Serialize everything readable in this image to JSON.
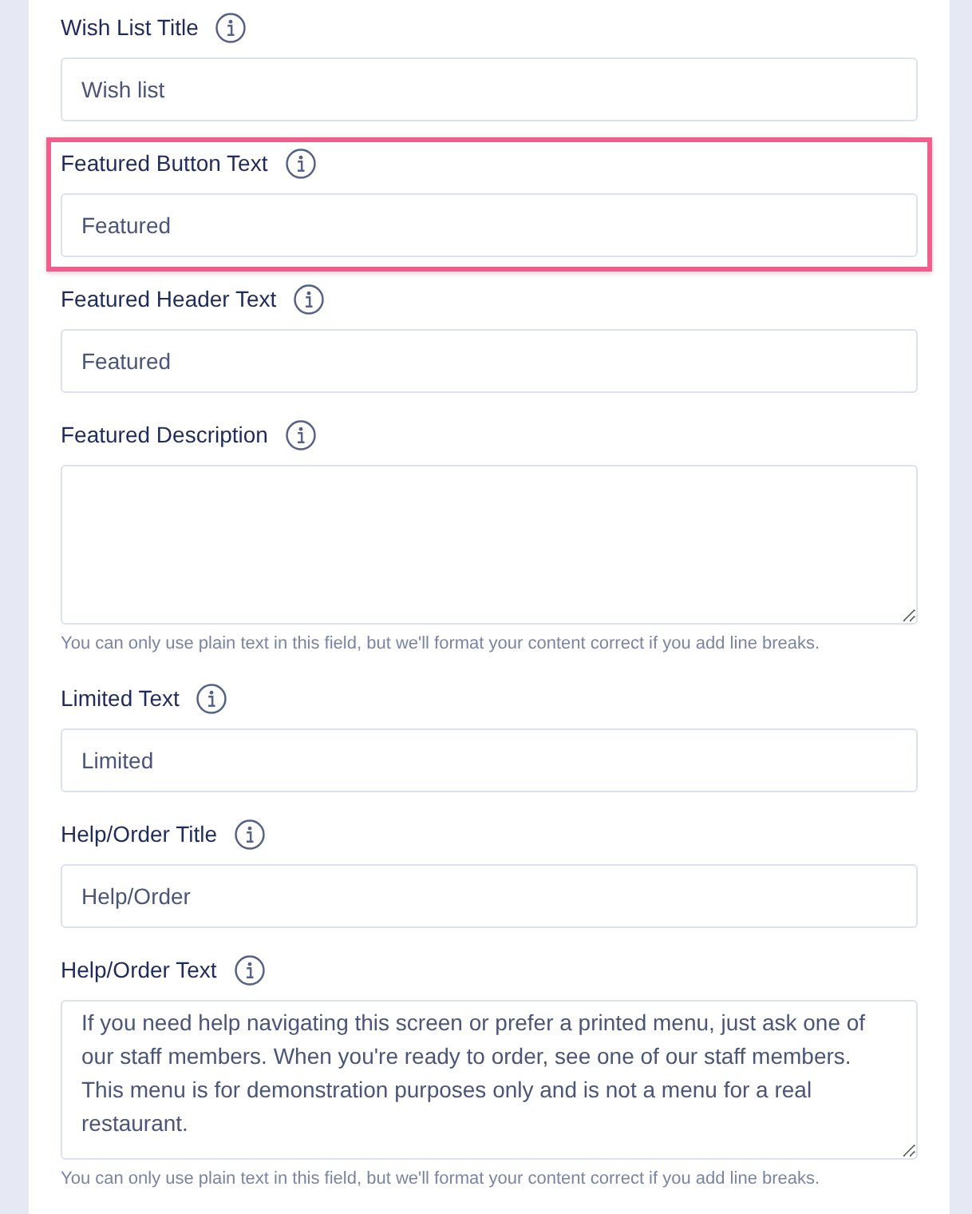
{
  "fields": [
    {
      "kind": "text",
      "label": "Wish List Title",
      "value": "Wish list",
      "highlighted": false
    },
    {
      "kind": "text",
      "label": "Featured Button Text",
      "value": "Featured",
      "highlighted": true
    },
    {
      "kind": "text",
      "label": "Featured Header Text",
      "value": "Featured",
      "highlighted": false
    },
    {
      "kind": "textarea",
      "label": "Featured Description",
      "help": "You can only use plain text in this field, but we'll format your content correct if you add line breaks.",
      "highlighted": false
    },
    {
      "kind": "text",
      "label": "Limited Text",
      "value": "Limited",
      "highlighted": false
    },
    {
      "kind": "text",
      "label": "Help/Order Title",
      "value": "Help/Order",
      "highlighted": false
    },
    {
      "kind": "textarea",
      "label": "Help/Order Text",
      "value": "If you need help navigating this screen or prefer a printed menu, just ask one of our staff members. When you're ready to order, see one of our staff members. This menu is for demonstration purposes only and is not a menu for a real restaurant.",
      "help": "You can only use plain text in this field, but we'll format your content correct if you add line breaks.",
      "highlighted": false
    }
  ]
}
